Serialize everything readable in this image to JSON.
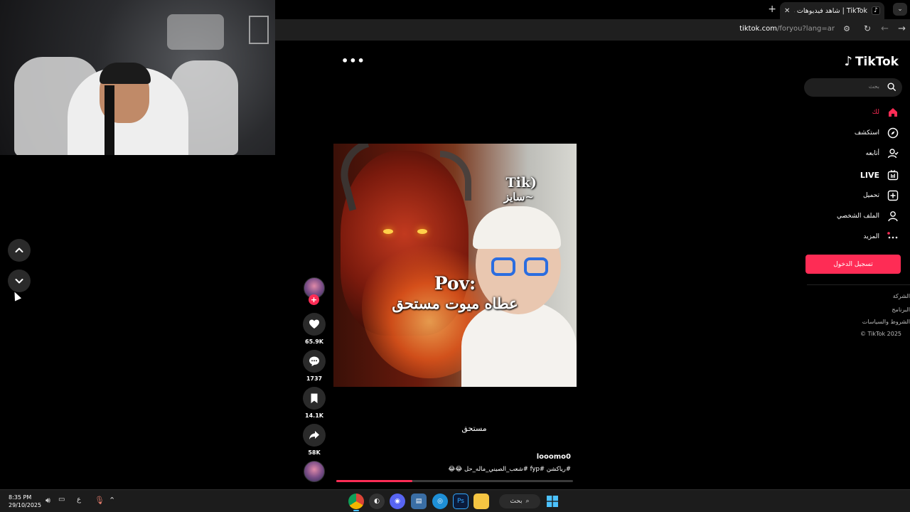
{
  "browser": {
    "tab_title": "TikTok | شاهد فيديوهات متصدرة",
    "tab_favicon": "tiktok-icon",
    "new_tab": "+",
    "close_tab": "✕",
    "url_host": "tiktok.com",
    "url_path": "/foryou?lang=ar"
  },
  "tiktok": {
    "logo_text": "TikTok",
    "search_placeholder": "بحث",
    "menu": [
      {
        "label": "لك",
        "icon": "home-icon",
        "active": true
      },
      {
        "label": "استكشف",
        "icon": "compass-icon"
      },
      {
        "label": "أتابعه",
        "icon": "following-icon"
      },
      {
        "label": "LIVE",
        "icon": "live-icon"
      },
      {
        "label": "تحميل",
        "icon": "upload-icon"
      },
      {
        "label": "الملف الشخصي",
        "icon": "profile-icon"
      },
      {
        "label": "المزيد",
        "icon": "more-icon"
      }
    ],
    "login_button": "تسجيل الدخول",
    "footer_links": [
      "الشركة",
      "البرنامج",
      "الشروط والسياسات",
      "© TikTok 2025"
    ],
    "accent_color": "#fe2c55"
  },
  "video": {
    "overlay_tik": "Tik)",
    "overlay_saiz": "سايز~",
    "overlay_pov": "Pov:",
    "overlay_arabic": "عطاه ميوت مستحق",
    "caption_center": "مستحق",
    "username": "looomo0",
    "description": "#رياكشن  #fyp  #شعب_الصيني_ماله_حل 😂😂",
    "progress": 0.32,
    "likes": "65.9K",
    "comments": "1737",
    "saves": "14.1K",
    "shares": "58K"
  },
  "taskbar": {
    "time": "8:35 PM",
    "date": "29/10/2025",
    "lang": "ع",
    "search_label": "بحث"
  }
}
